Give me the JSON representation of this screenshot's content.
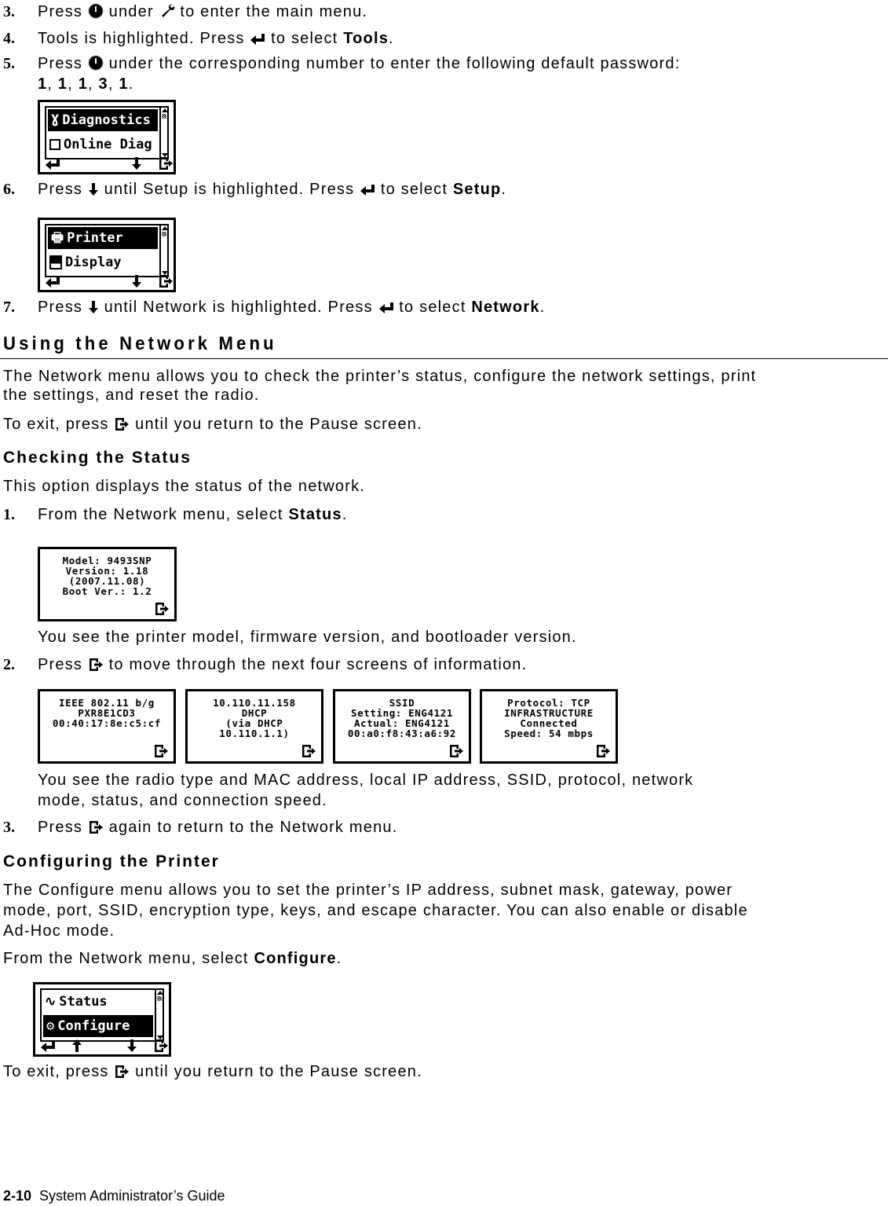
{
  "steps_top": [
    {
      "num": "3.",
      "parts": [
        "Press ",
        "{button-icon}",
        " under ",
        "{wrench-icon}",
        " to enter the main menu."
      ]
    },
    {
      "num": "4.",
      "text_a": "Tools is highlighted.  Press ",
      "text_b": " to select ",
      "bold": "Tools",
      "end": "."
    },
    {
      "num": "5.",
      "text_a": "Press ",
      "text_b": " under the corresponding number to enter the following default password:",
      "password": [
        "1",
        "1",
        "1",
        "3",
        "1"
      ]
    },
    {
      "num": "6.",
      "text_a": "Press ",
      "text_b": " until Setup is highlighted. Press ",
      "text_c": " to select ",
      "bold": "Setup",
      "end": "."
    },
    {
      "num": "7.",
      "text_a": "Press ",
      "text_b": " until Network is highlighted.  Press ",
      "text_c": " to select ",
      "bold": "Network",
      "end": "."
    }
  ],
  "step3": {
    "a": "Press ",
    "b": " under ",
    "c": " to enter the main menu."
  },
  "screens": {
    "diagnostics": {
      "items": [
        {
          "icon": "stethoscope-icon",
          "label": "Diagnostics",
          "selected": true
        },
        {
          "icon": "checkbox-icon",
          "label": "Online Diag",
          "selected": false
        }
      ]
    },
    "setup": {
      "items": [
        {
          "icon": "printer-icon",
          "label": "Printer",
          "selected": true
        },
        {
          "icon": "display-icon",
          "label": "Display",
          "selected": false
        }
      ]
    },
    "status1": {
      "lines": [
        "Model: 9493SNP",
        "Version: 1.18",
        "(2007.11.08)",
        "Boot Ver.: 1.2"
      ]
    },
    "status_more": [
      {
        "lines": [
          "IEEE 802.11 b/g",
          "PXR8E1CD3",
          "00:40:17:8e:c5:cf"
        ]
      },
      {
        "lines": [
          "10.110.11.158",
          "DHCP",
          "(via DHCP",
          "10.110.1.1)"
        ]
      },
      {
        "lines": [
          "SSID",
          "Setting: ENG4121",
          "Actual: ENG4121",
          "00:a0:f8:43:a6:92"
        ]
      },
      {
        "lines": [
          "Protocol: TCP",
          "INFRASTRUCTURE",
          "Connected",
          "Speed: 54 mbps"
        ]
      }
    ],
    "network": {
      "items": [
        {
          "icon": "pulse-icon",
          "label": "Status",
          "selected": false
        },
        {
          "icon": "gears-icon",
          "label": "Configure",
          "selected": true
        }
      ]
    }
  },
  "section": {
    "title": "Using the Network Menu",
    "intro_line1": "The Network menu allows you to check the printer’s status, configure the network settings, print",
    "intro_line2": "the settings, and reset the radio.",
    "exit_a": "To exit, press ",
    "exit_b": " until you return to the Pause screen."
  },
  "status_section": {
    "title": "Checking the Status",
    "intro": "This option displays the status of the network.",
    "step1": {
      "num": "1.",
      "a": "From the Network menu, select ",
      "bold": "Status",
      "end": "."
    },
    "note1": "You see the printer model, firmware version, and bootloader version.",
    "step2": {
      "num": "2.",
      "a": "Press ",
      "b": " to move through the next four screens of information."
    },
    "note2_line1": "You see the radio type and MAC address, local IP address, SSID, protocol, network",
    "note2_line2": "mode, status, and connection speed.",
    "step3": {
      "num": "3.",
      "a": "Press ",
      "b": " again to return to the Network menu."
    }
  },
  "configure_section": {
    "title": "Configuring the Printer",
    "line1": "The Configure menu allows you to set the printer’s IP address, subnet mask, gateway, power",
    "line2": "mode, port, SSID, encryption type, keys, and escape character. You can also enable or disable",
    "line3": "Ad-Hoc mode.",
    "select_a": "From the Network menu, select ",
    "select_bold": "Configure",
    "select_end": ".",
    "exit_a": "To exit, press ",
    "exit_b": " until you return to the Pause screen."
  },
  "footer": {
    "page": "2-10",
    "title": "System Administrator’s Guide"
  }
}
